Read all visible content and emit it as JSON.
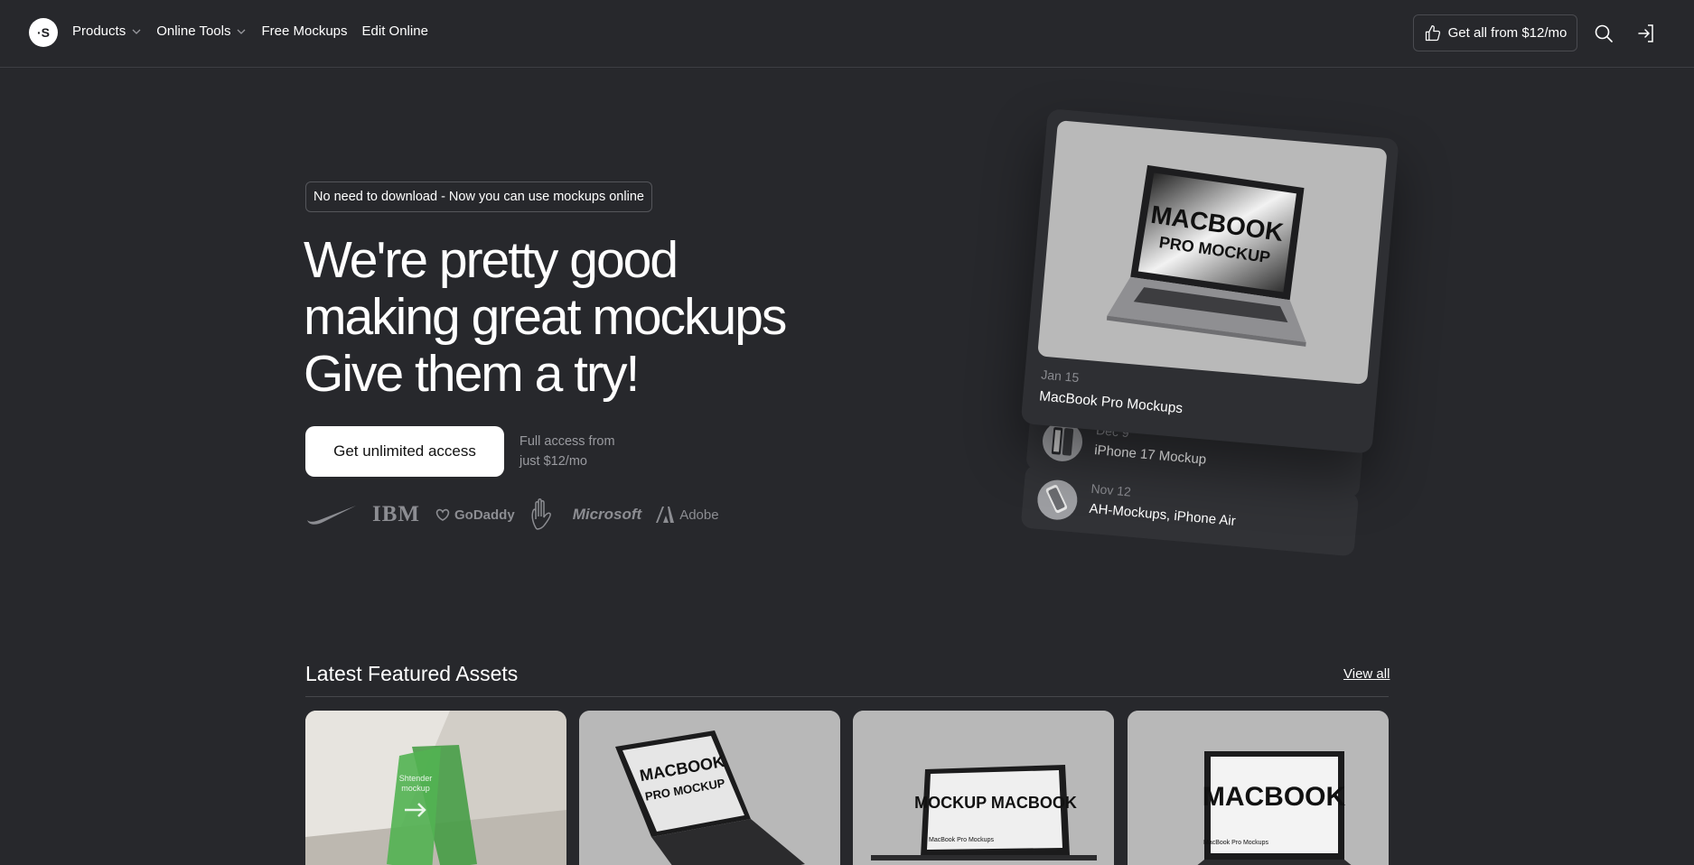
{
  "header": {
    "logo_text": "·S",
    "nav": [
      {
        "label": "Products",
        "has_dropdown": true
      },
      {
        "label": "Online Tools",
        "has_dropdown": true
      },
      {
        "label": "Free Mockups",
        "has_dropdown": false
      },
      {
        "label": "Edit Online",
        "has_dropdown": false
      }
    ],
    "cta_label": "Get all from $12/mo",
    "cta_icon": "thumbs-up-icon",
    "search_icon": "search-icon",
    "login_icon": "login-icon"
  },
  "hero": {
    "pill_text": "No need to download - Now you can use mockups online",
    "title_lines": [
      "We're pretty good",
      "making great mockups",
      "Give them a try!"
    ],
    "primary_button": "Get unlimited access",
    "access_note_line1": "Full access from",
    "access_note_line2": "just $12/mo",
    "brands": {
      "nike": "nike-logo",
      "ibm": "IBM",
      "godaddy": "GoDaddy",
      "hand": "hand-logo",
      "microsoft": "Microsoft",
      "adobe": "Adobe"
    }
  },
  "featured_card": {
    "image_text_line1": "MACBOOK",
    "image_text_line2": "PRO MOCKUP",
    "date": "Jan 15",
    "title": "MacBook Pro Mockups"
  },
  "recent_items": [
    {
      "date": "Dec 9",
      "title": "iPhone 17 Mockup"
    },
    {
      "date": "Nov 12",
      "title": "AH-Mockups, iPhone Air"
    }
  ],
  "latest": {
    "title": "Latest Featured Assets",
    "view_all": "View all",
    "assets": [
      {
        "text_line1": "Shtender",
        "text_line2": "mockup"
      },
      {
        "text_line1": "MACBOOK",
        "text_line2": "PRO MOCKUP"
      },
      {
        "text_line1": "MOCKUP MACBOOK",
        "text_line2": "MacBook Pro Mockups"
      },
      {
        "text_line1": "MACBOOK",
        "text_line2": "MacBook Pro Mockups"
      }
    ]
  },
  "colors": {
    "background": "#27282c",
    "text": "#ffffff",
    "muted": "#9a9ba0",
    "card": "#2e2f33",
    "image_gray": "#b9b9b9"
  }
}
